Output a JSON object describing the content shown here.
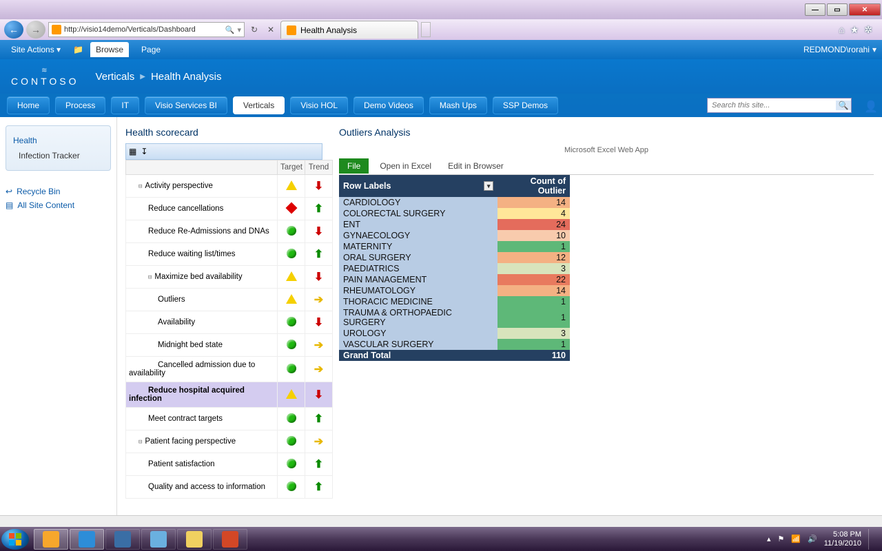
{
  "window_controls": {
    "min": "—",
    "max": "▭",
    "close": "✕"
  },
  "browser": {
    "url": "http://visio14demo/Verticals/Dashboard",
    "tab_title": "Health Analysis",
    "icons": {
      "home": "⌂",
      "favorite": "★",
      "tools": "✲"
    }
  },
  "sharepoint": {
    "user": "REDMOND\\rorahi",
    "ribbon_tabs": {
      "site_actions": "Site Actions",
      "browse": "Browse",
      "page": "Page"
    },
    "logo_text": "CONTOSO",
    "breadcrumb": [
      "Verticals",
      "Health Analysis"
    ],
    "nav_tabs": [
      "Home",
      "Process",
      "IT",
      "Visio Services BI",
      "Verticals",
      "Visio HOL",
      "Demo Videos",
      "Mash Ups",
      "SSP Demos"
    ],
    "active_nav": "Verticals",
    "search_placeholder": "Search this site..."
  },
  "leftnav": {
    "items": [
      {
        "label": "Health",
        "indent": false
      },
      {
        "label": "Infection Tracker",
        "indent": true
      }
    ],
    "utilities": [
      {
        "label": "Recycle Bin",
        "icon": "↩"
      },
      {
        "label": "All Site Content",
        "icon": "▤"
      }
    ]
  },
  "scorecard": {
    "title": "Health scorecard",
    "headers": {
      "target": "Target",
      "trend": "Trend"
    },
    "rows": [
      {
        "label": "Activity perspective",
        "depth": 0,
        "exp": "⊟",
        "target": "yellow-tri",
        "trend": "down-red"
      },
      {
        "label": "Reduce cancellations",
        "depth": 1,
        "target": "red-diamond",
        "trend": "up-green"
      },
      {
        "label": "Reduce Re-Admissions and DNAs",
        "depth": 1,
        "target": "green-circle",
        "trend": "down-red"
      },
      {
        "label": "Reduce waiting list/times",
        "depth": 1,
        "target": "green-circle",
        "trend": "up-green"
      },
      {
        "label": "Maximize bed availability",
        "depth": 1,
        "exp": "⊟",
        "target": "yellow-tri",
        "trend": "down-red"
      },
      {
        "label": "Outliers",
        "depth": 2,
        "target": "yellow-tri",
        "trend": "right-yellow"
      },
      {
        "label": "Availability",
        "depth": 2,
        "target": "green-circle",
        "trend": "down-red"
      },
      {
        "label": "Midnight bed state",
        "depth": 2,
        "target": "green-circle",
        "trend": "right-yellow"
      },
      {
        "label": "Cancelled admission due to availability",
        "depth": 2,
        "target": "green-circle",
        "trend": "right-yellow"
      },
      {
        "label": "Reduce hospital acquired infection",
        "depth": 1,
        "target": "yellow-tri",
        "trend": "down-red",
        "highlight": true
      },
      {
        "label": "Meet contract targets",
        "depth": 1,
        "target": "green-circle",
        "trend": "up-green"
      },
      {
        "label": "Patient facing perspective",
        "depth": 0,
        "exp": "⊟",
        "target": "green-circle",
        "trend": "right-yellow"
      },
      {
        "label": "Patient satisfaction",
        "depth": 1,
        "target": "green-circle",
        "trend": "up-green"
      },
      {
        "label": "Quality and access to information",
        "depth": 1,
        "target": "green-circle",
        "trend": "up-green"
      }
    ]
  },
  "outliers": {
    "title": "Outliers Analysis",
    "app_label": "Microsoft Excel Web App",
    "menu": {
      "file": "File",
      "open": "Open in Excel",
      "edit": "Edit in Browser"
    },
    "headers": {
      "row": "Row Labels",
      "count": "Count of Outlier"
    },
    "rows": [
      {
        "label": "CARDIOLOGY",
        "value": 14,
        "color": "#f4b183"
      },
      {
        "label": "COLORECTAL SURGERY",
        "value": 4,
        "color": "#ffe699"
      },
      {
        "label": "ENT",
        "value": 24,
        "color": "#e46c5c"
      },
      {
        "label": "GYNAECOLOGY",
        "value": 10,
        "color": "#f8cbad"
      },
      {
        "label": "MATERNITY",
        "value": 1,
        "color": "#5eb878"
      },
      {
        "label": "ORAL SURGERY",
        "value": 12,
        "color": "#f4b183"
      },
      {
        "label": "PAEDIATRICS",
        "value": 3,
        "color": "#d8e4bc"
      },
      {
        "label": "PAIN MANAGEMENT",
        "value": 22,
        "color": "#e87a5e"
      },
      {
        "label": "RHEUMATOLOGY",
        "value": 14,
        "color": "#f4b183"
      },
      {
        "label": "THORACIC MEDICINE",
        "value": 1,
        "color": "#5eb878"
      },
      {
        "label": "TRAUMA & ORTHOPAEDIC SURGERY",
        "value": 1,
        "color": "#5eb878"
      },
      {
        "label": "UROLOGY",
        "value": 3,
        "color": "#d8e4bc"
      },
      {
        "label": "VASCULAR SURGERY",
        "value": 1,
        "color": "#5eb878"
      }
    ],
    "total": {
      "label": "Grand Total",
      "value": 110
    }
  },
  "taskbar": {
    "apps": [
      "outlook",
      "ie",
      "visio",
      "notepad",
      "explorer",
      "powerpoint"
    ],
    "time": "5:08 PM",
    "date": "11/19/2010"
  }
}
